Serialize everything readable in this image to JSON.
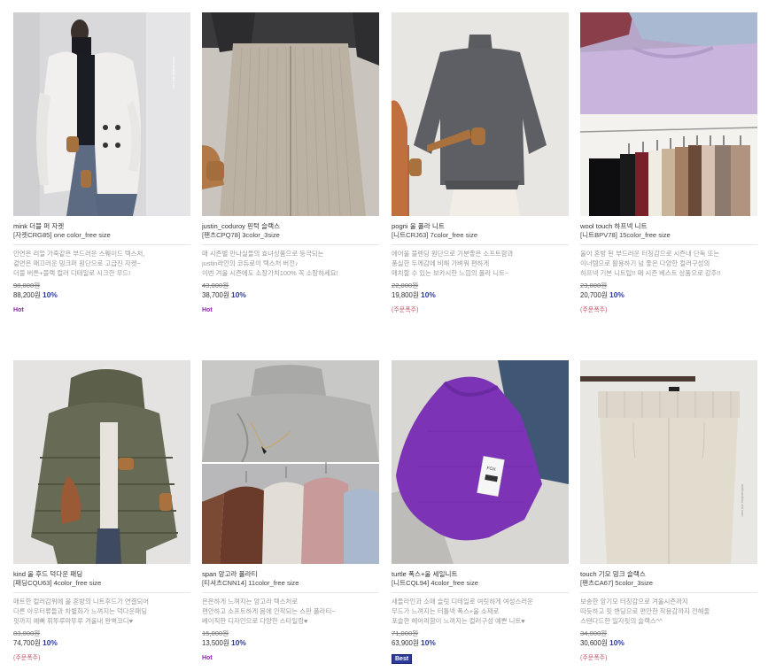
{
  "products": [
    {
      "name": "mink 더블 퍼 자켓",
      "code": "[자켓CRG85] one color_free size",
      "desc": [
        "안연은 리얼 가죽같은 부드러운 스웨이드 텍스처,",
        "겉면은 매끄러운 밍크퍼 원단으로 고급진 자켓~",
        "더블 버튼+블랙 컬러 디테일로 시크한 무드!"
      ],
      "orig_price": "98,000원",
      "sale_price": "88,200원",
      "discount": "10%",
      "badge": "Hot",
      "badge_type": "hot",
      "image_icon": "white-mink-jacket-photo",
      "watermark": "mellowdiary dot com"
    },
    {
      "name": "justin_coduroy 핀턱 슬랙스",
      "code": "[팬츠CPQ78] 3color_3size",
      "desc": [
        "매 시즌별 만나실들의 효녀상품으로 등극되는",
        "justin라인의 코듀로이 텍스처 버전♪",
        "이번 겨울 시즌에도 소장가치100% 꼭 소장하세요!"
      ],
      "orig_price": "43,000원",
      "sale_price": "38,700원",
      "discount": "10%",
      "badge": "Hot",
      "badge_type": "hot",
      "image_icon": "corduroy-slacks-photo"
    },
    {
      "name": "pogni 울 폴라 니트",
      "code": "[니트CRJ63] 7color_free size",
      "desc": [
        "에어울 블렌딩 원단으로 기분좋은 소프트함과",
        "풍실한 두께감에 비해 가벼워 편하게",
        "매치할 수 있는 보카시한 느낌의 폴라 니트~"
      ],
      "orig_price": "22,000원",
      "sale_price": "19,800원",
      "discount": "10%",
      "badge": "(주문폭주)",
      "badge_type": "order",
      "image_icon": "grey-wool-knit-photo"
    },
    {
      "name": "wool touch 하프넥 니트",
      "code": "[니트BPV78] 15color_free size",
      "desc": [
        "울이 혼방 된 부드러운 터칭감으로 시즌내 단독 또는",
        "이너템으로 활용하기 넘 좋은 다양한 컬러구성의",
        "하프넥 기본 니트탑!! 매 시즌 베스트 상품으로 강추!!"
      ],
      "orig_price": "23,000원",
      "sale_price": "20,700원",
      "discount": "10%",
      "badge": "(주문폭주)",
      "badge_type": "order",
      "image_icon": "halfneck-knit-colors-photo"
    },
    {
      "name": "kind 울 후드 덕다운 패딩",
      "code": "[패딩CQU63] 4color_free size",
      "desc": [
        "매트한 컬러감위에 울 혼방의 니트후드가 연결되어",
        "다른 아우터류들과 차별화가 느껴지는 덕다운패딩",
        "핏까지 예뻐 휘뚜루마뚜루 겨울내 완벽코디♥"
      ],
      "orig_price": "83,000원",
      "sale_price": "74,700원",
      "discount": "10%",
      "badge": "(주문폭주)",
      "badge_type": "order",
      "image_icon": "khaki-down-padding-photo"
    },
    {
      "name": "span 앙고라 폴라티",
      "code": "[티셔츠CNN14] 11color_free size",
      "desc": [
        "은은하게 느껴지는 앙고라 텍스처로",
        "편안하고 소프트하게 몸에 안착되는 스판 폴라티~",
        "베이직한 디자인으로 다양한 스타일링♥"
      ],
      "orig_price": "15,000원",
      "sale_price": "13,500원",
      "discount": "10%",
      "badge": "Hot",
      "badge_type": "hot",
      "image_icon": "angora-turtleneck-photo"
    },
    {
      "name": "turtle 폭스+울 세일니트",
      "code": "[니트CQL94] 4color_free size",
      "desc": [
        "새들라인과 소매 슬릿 디테일로 여릿하게 여성스러운",
        "무드가 느껴지는 터틀넥 폭스+울 소재로",
        "포슬한 헤어리함이 느껴지는 컬러구성 예쁜 니트♥"
      ],
      "orig_price": "71,000원",
      "sale_price": "63,900원",
      "discount": "10%",
      "badge": "Best",
      "badge_type": "best",
      "image_icon": "purple-fox-knit-photo",
      "tag_text": "FOX"
    },
    {
      "name": "touch 기모 밍크 슬랙스",
      "code": "[팬츠CA67] 5color_3size",
      "desc": [
        "보송한 앙기모 터칭감으로 겨울시즌까지",
        "따듯하고 핏 밴딩으로 편안한 착용감까지 전해줄",
        "스탠다드한 일자핏의 슬랙스^^"
      ],
      "orig_price": "34,000원",
      "sale_price": "30,600원",
      "discount": "10%",
      "badge": "(주문폭주)",
      "badge_type": "order",
      "image_icon": "beige-mink-slacks-photo",
      "watermark": "mellowdiary dot com"
    }
  ]
}
